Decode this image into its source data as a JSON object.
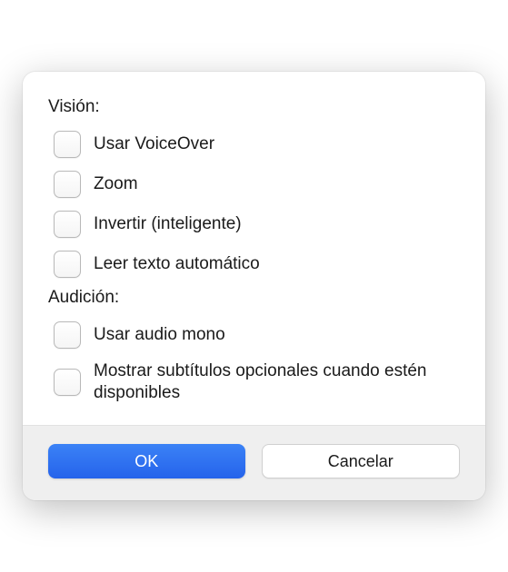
{
  "sections": {
    "vision": {
      "label": "Visión:",
      "options": {
        "voiceover": "Usar VoiceOver",
        "zoom": "Zoom",
        "invert": "Invertir (inteligente)",
        "autotext": "Leer texto automático"
      }
    },
    "hearing": {
      "label": "Audición:",
      "options": {
        "mono": "Usar audio mono",
        "captions": "Mostrar subtítulos opcionales cuando estén disponibles"
      }
    }
  },
  "buttons": {
    "ok": "OK",
    "cancel": "Cancelar"
  }
}
